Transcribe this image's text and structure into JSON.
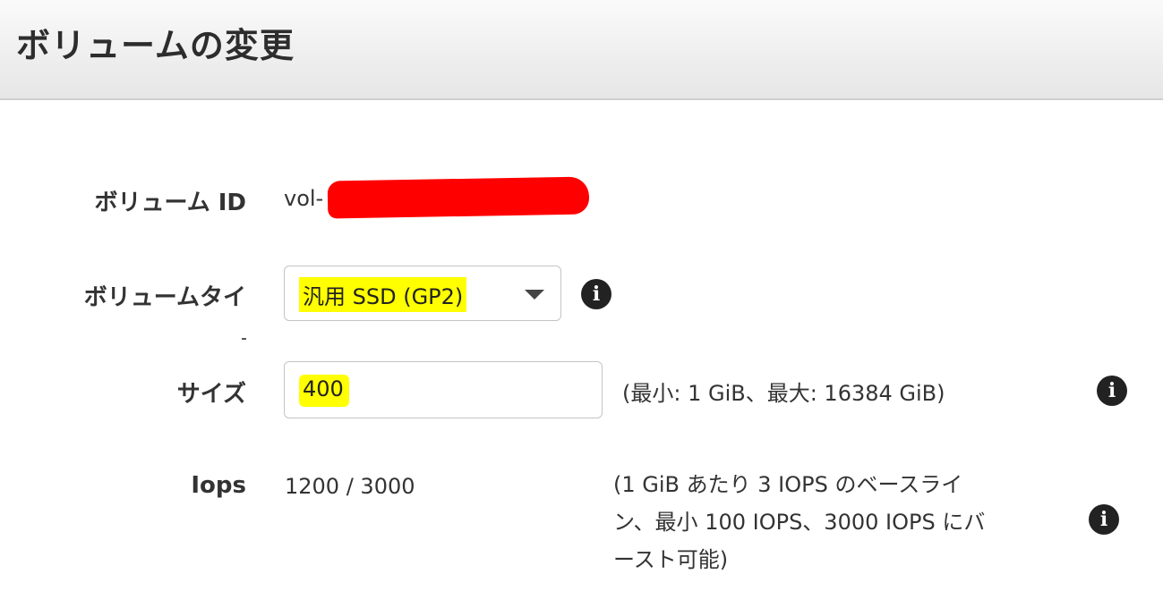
{
  "header": {
    "title": "ボリュームの変更"
  },
  "volume_id": {
    "label": "ボリューム ID",
    "value_prefix": "vol-",
    "redacted": true
  },
  "volume_type": {
    "label": "ボリュームタイ",
    "selected": "汎用 SSD (GP2)",
    "icon": "info-icon"
  },
  "size": {
    "label": "サイズ",
    "value": "400",
    "hint": "(最小: 1 GiB、最大: 16384 GiB)",
    "icon": "info-icon"
  },
  "iops": {
    "label": "Iops",
    "value": "1200 / 3000",
    "hint_line1": "(1 GiB あたり 3 IOPS のベースライ",
    "hint_line2": "ン、最小 100 IOPS、3000 IOPS にバ",
    "hint_line3": "ースト可能)",
    "icon": "info-icon"
  },
  "colors": {
    "highlight": "#ffff00",
    "redaction": "#ff0000",
    "header_bg": "#ececec"
  }
}
